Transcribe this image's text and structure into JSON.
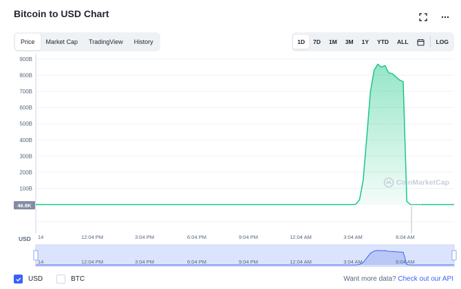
{
  "header": {
    "title": "Bitcoin to USD Chart",
    "fullscreen_icon": "expand-icon",
    "more_icon": "more-dots-icon"
  },
  "tabs": [
    {
      "label": "Price",
      "active": true
    },
    {
      "label": "Market Cap",
      "active": false
    },
    {
      "label": "TradingView",
      "active": false
    },
    {
      "label": "History",
      "active": false
    }
  ],
  "ranges": [
    {
      "label": "1D",
      "active": true
    },
    {
      "label": "7D",
      "active": false
    },
    {
      "label": "1M",
      "active": false
    },
    {
      "label": "3M",
      "active": false
    },
    {
      "label": "1Y",
      "active": false
    },
    {
      "label": "YTD",
      "active": false
    },
    {
      "label": "ALL",
      "active": false
    }
  ],
  "calendar_icon": "calendar-icon",
  "log_label": "LOG",
  "currency_axis_label": "USD",
  "current_price_label": "46.8K",
  "watermark": "CoinMarketCap",
  "legend": {
    "usd": {
      "label": "USD",
      "checked": true
    },
    "btc": {
      "label": "BTC",
      "checked": false
    }
  },
  "api": {
    "text": "Want more data?",
    "link": "Check out our API"
  },
  "colors": {
    "line": "#16c784",
    "accent": "#3861fb",
    "nav_fill": "#dbe4fc"
  },
  "chart_data": {
    "type": "area",
    "y_ticks": [
      "100B",
      "200B",
      "300B",
      "400B",
      "500B",
      "600B",
      "700B",
      "800B",
      "900B"
    ],
    "y_tick_values": [
      100,
      200,
      300,
      400,
      500,
      600,
      700,
      800,
      900
    ],
    "y_unit": "B",
    "ylim": [
      0,
      900
    ],
    "x_ticks": [
      "14",
      "12:04 PM",
      "3:04 PM",
      "6:04 PM",
      "9:04 PM",
      "12:04 AM",
      "3:04 AM",
      "6:04 AM"
    ],
    "grid": true,
    "series": [
      {
        "values": [
          0,
          0,
          0,
          0,
          0,
          0,
          0,
          0,
          0,
          0,
          0,
          0,
          0,
          0,
          0,
          0,
          0,
          0,
          0,
          0,
          0,
          0,
          0,
          0,
          0,
          0,
          0,
          0,
          0,
          0,
          0,
          0,
          0,
          0,
          0,
          0,
          0,
          0,
          0,
          0,
          0,
          0,
          0,
          0,
          0,
          0,
          0,
          0,
          0,
          0,
          0,
          0,
          0,
          0,
          0,
          0,
          0,
          0,
          0,
          0,
          0,
          0,
          0,
          0,
          0,
          0,
          0,
          0,
          0,
          0,
          0,
          0,
          0,
          0,
          0,
          0,
          0,
          0,
          0,
          0,
          0,
          0,
          0,
          0,
          0,
          0,
          0,
          0,
          2,
          30,
          150,
          420,
          700,
          830,
          868,
          850,
          860,
          815,
          810,
          790,
          770,
          760,
          20,
          0,
          0,
          0,
          0,
          0,
          0,
          0,
          0,
          0,
          0,
          0,
          0,
          0
        ]
      }
    ]
  }
}
